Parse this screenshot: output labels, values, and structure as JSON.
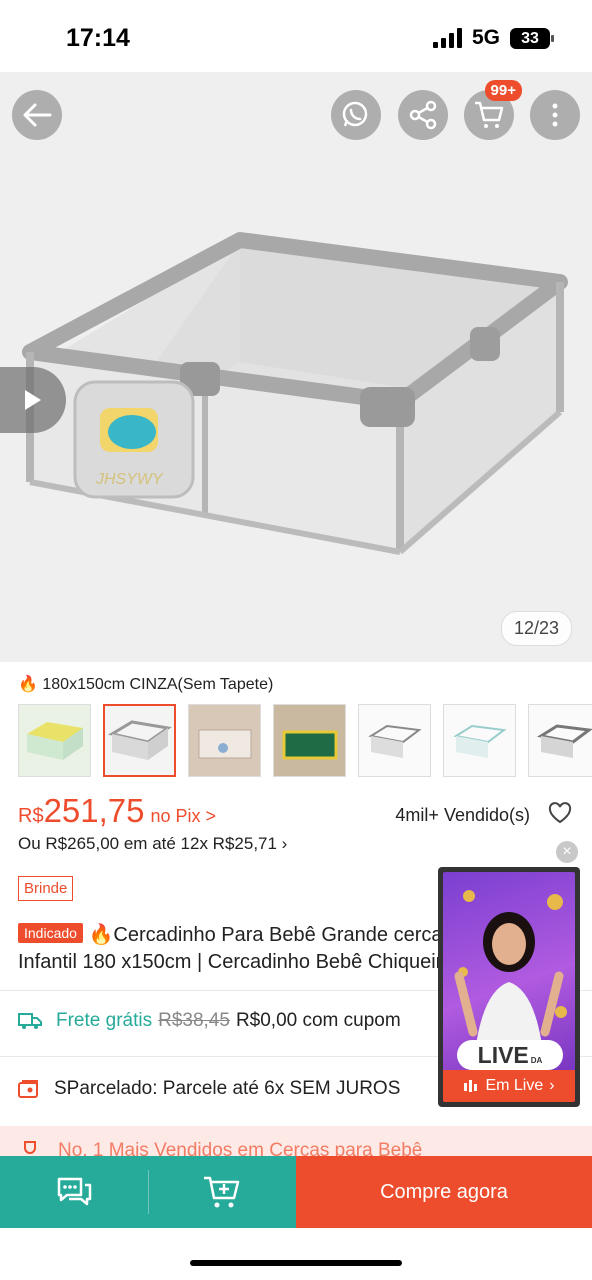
{
  "status_bar": {
    "time": "17:14",
    "network": "5G",
    "battery": "33"
  },
  "header": {
    "back_icon": "arrow-left-icon",
    "whatsapp_icon": "whatsapp-icon",
    "share_icon": "share-icon",
    "cart_badge": "99+",
    "more_icon": "more-vertical-icon"
  },
  "gallery": {
    "counter": "12/23",
    "brand_on_product": "JHSYWY"
  },
  "variant": {
    "selected": "180x150cm CINZA(Sem Tapete)",
    "thumbnails": 7,
    "selected_index": 1
  },
  "price": {
    "currency": "R$",
    "value": "251,75",
    "pix_label": "no Pix >",
    "sold": "4mil+ Vendido(s)",
    "installments": "Ou R$265,00 em até 12x R$25,71 ›",
    "gift_badge": "Brinde"
  },
  "product": {
    "tag": "Indicado",
    "title_line1": "🔥Cercadinho Para Bebê Grande cercadinho",
    "title_line2": "Infantil 180 x150cm | Cercadinho Bebê Chiqueirinho"
  },
  "shipping": {
    "label": "Frete grátis",
    "old_price": "R$38,45",
    "new_price": "R$0,00 com cupom"
  },
  "installment_promo": {
    "text": "SParcelado: Parcele até 6x SEM JUROS"
  },
  "ranking": {
    "text": "No. 1 Mais Vendidos em Cercas para Bebê"
  },
  "live": {
    "word": "LIVE",
    "button": "Em Live",
    "sub": "DA"
  },
  "bottom_bar": {
    "buy_now": "Compre agora"
  },
  "colors": {
    "brand": "#ee4d2d",
    "teal": "#26aa99"
  }
}
